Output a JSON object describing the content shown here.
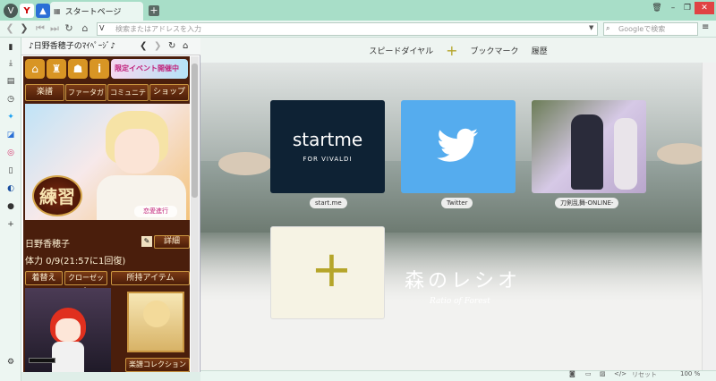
{
  "tabs": [
    {
      "title": "スタートページ"
    }
  ],
  "address": {
    "placeholder": "検索またはアドレスを入力",
    "search_placeholder": "Googleで検索"
  },
  "webpanel": {
    "title": "♪日野香穂子のﾏｲﾍﾟｰｼﾞ♪",
    "event_text": "限定イベント開催中",
    "nav": [
      "楽譜",
      "ファータガチャ",
      "コミュニティ",
      "ショップ"
    ],
    "practice": "練習",
    "romance": "恋愛進行",
    "player_name": "日野香穂子",
    "detail_button": "詳細",
    "stamina": "体力 0/9(21:57に1回復)",
    "actions": [
      "着替え",
      "クローゼット",
      "所持アイテム"
    ],
    "collection_button": "楽譜コレクション"
  },
  "speeddial": {
    "header": [
      "スピードダイヤル",
      "ブックマーク",
      "履歴"
    ],
    "tiles": [
      {
        "label": "start.me",
        "logo_main": "startme",
        "logo_sub": "FOR VIVALDI"
      },
      {
        "label": "Twitter"
      },
      {
        "label": "刀剣乱舞-ONLINE-"
      }
    ],
    "bg_title": "森のレシオ",
    "bg_subtitle": "Ratio of Forest"
  },
  "statusbar": {
    "reset": "リセット",
    "zoom": "100 %"
  },
  "colors": {
    "tabbar": "#a8dec8",
    "twitter": "#55acee",
    "startme": "#0e2234"
  }
}
